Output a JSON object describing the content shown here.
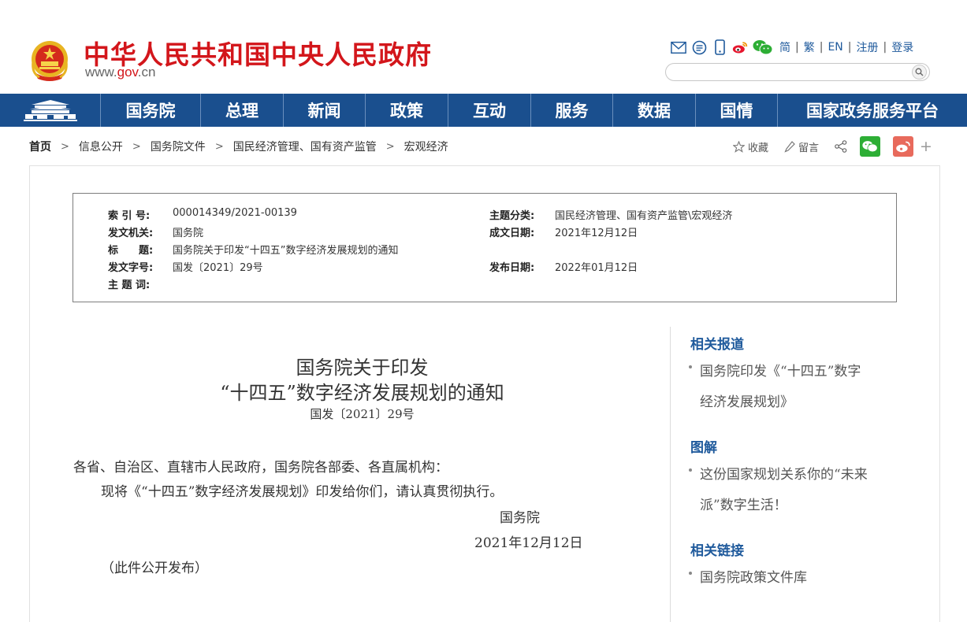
{
  "header": {
    "site_title": "中华人民共和国中央人民政府",
    "url_prefix": "www.",
    "url_gov": "gov",
    "url_suffix": ".cn",
    "icons": [
      "mail-icon",
      "chat-icon",
      "mobile-icon",
      "weibo-icon",
      "wechat-icon"
    ],
    "links": [
      "简",
      "繁",
      "EN",
      "注册",
      "登录"
    ],
    "search_placeholder": ""
  },
  "nav": {
    "home_icon": "tiananmen-icon",
    "items": [
      "国务院",
      "总理",
      "新闻",
      "政策",
      "互动",
      "服务",
      "数据",
      "国情",
      "国家政务服务平台"
    ]
  },
  "breadcrumb": [
    "首页",
    "信息公开",
    "国务院文件",
    "国民经济管理、国有资产监管",
    "宏观经济"
  ],
  "tools": {
    "favorite": "收藏",
    "comment": "留言",
    "plus": "+"
  },
  "info": {
    "index_label": "索 引 号:",
    "index_value": "000014349/2021-00139",
    "category_label": "主题分类:",
    "category_value": "国民经济管理、国有资产监管\\宏观经济",
    "issuer_label": "发文机关:",
    "issuer_value": "国务院",
    "date_written_label": "成文日期:",
    "date_written_value": "2021年12月12日",
    "title_label": "标　　题:",
    "title_value": "国务院关于印发“十四五”数字经济发展规划的通知",
    "doc_no_label": "发文字号:",
    "doc_no_value": "国发〔2021〕29号",
    "publish_label": "发布日期:",
    "publish_value": "2022年01月12日",
    "keywords_label": "主 题 词:"
  },
  "article": {
    "title_line1": "国务院关于印发",
    "title_line2": "“十四五”数字经济发展规划的通知",
    "doc_no": "国发〔2021〕29号",
    "salutation": "各省、自治区、直辖市人民政府，国务院各部委、各直属机构：",
    "body": "现将《“十四五”数字经济发展规划》印发给你们，请认真贯彻执行。",
    "signer": "国务院",
    "date": "2021年12月12日",
    "note": "（此件公开发布）"
  },
  "sidebar": {
    "related_head": "相关报道",
    "related_line1": "国务院印发《“十四五”数字",
    "related_line2": "经济发展规划》",
    "diagram_head": "图解",
    "diagram_line1": "这份国家规划关系你的“未来",
    "diagram_line2": "派”数字生活！",
    "links_head": "相关链接",
    "links_item": "国务院政策文件库"
  }
}
